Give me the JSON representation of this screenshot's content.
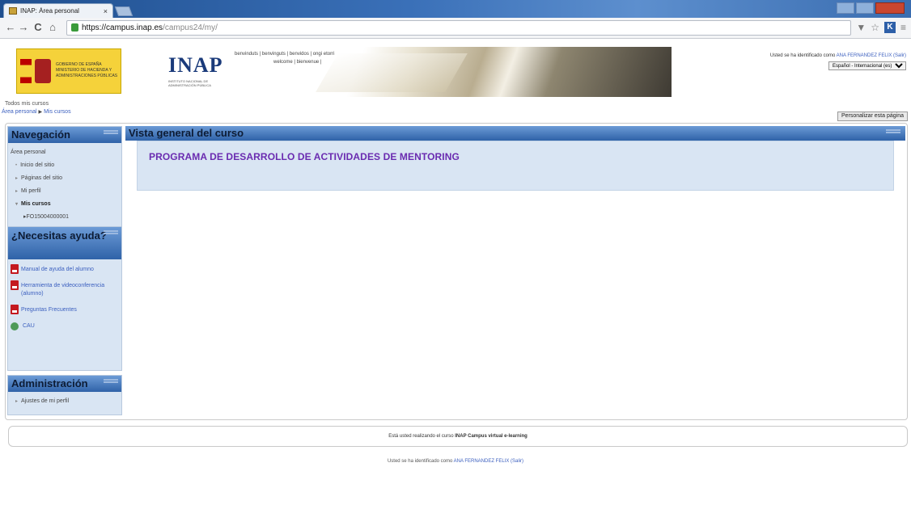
{
  "browser": {
    "tab_title": "INAP: Área personal",
    "tab_close": "×",
    "url_host": "https://campus.inap.es",
    "url_path": "/campus24/my/",
    "nav_back": "←",
    "nav_forward": "→",
    "nav_reload": "C",
    "nav_home": "⌂",
    "ext_label": "K",
    "star": "☆",
    "menu": "≡",
    "filter": "▼"
  },
  "header": {
    "gov_text": "GOBIERNO DE ESPAÑA MINISTERIO DE HACIENDA Y ADMINISTRACIONES PÚBLICAS",
    "inap_title": "INAP",
    "inap_sub": "INSTITUTO NACIONAL DE ADMINISTRACIÓN PÚBLICA",
    "langs_row1": "benvinduts  |  benvinguts  |  benvidos  |  ongi etorri",
    "langs_row2": "welcome  |  bienvenue  |",
    "user_text": "Usted se ha identificado como ",
    "user_name": "ANA FERNANDEZ FELIX",
    "user_logout": " (Salir)",
    "lang_select": "Español - Internacional (es)"
  },
  "crumbs": {
    "nav_title": "Todos mis cursos",
    "bc_home": "Área personal",
    "bc_sep": "▶",
    "bc_current": "Mis cursos"
  },
  "customize_label": "Personalizar esta página",
  "navigation": {
    "title": "Navegación",
    "root": "Área personal",
    "items": [
      "Inicio del sitio",
      "Páginas del sitio",
      "Mi perfil"
    ],
    "courses_label": "Mis cursos",
    "course_code": "FO15004000001",
    "bullet_open": "▸",
    "bullet_closed": "▾"
  },
  "help": {
    "title": "¿Necesitas ayuda?",
    "links": [
      "Manual de ayuda del alumno",
      "Herramienta de videoconferencia (alumno)",
      "Preguntas Frecuentes",
      "CAU"
    ]
  },
  "admin": {
    "title": "Administración",
    "item": "Ajustes de mi perfil"
  },
  "course_overview": {
    "title": "Vista general del curso",
    "course_name": "PROGRAMA DE DESARROLLO DE ACTIVIDADES DE MENTORING"
  },
  "footer": {
    "text_pre": "Está usted realizando el curso ",
    "course": "INAP Campus virtual e-learning",
    "user_pre": "Usted se ha identificado como ",
    "user_name": "ANA FERNANDEZ FELIX",
    "logout": " (Salir)"
  }
}
